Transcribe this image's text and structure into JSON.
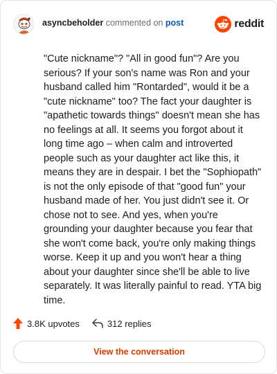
{
  "comment": {
    "username": "asyncbeholder",
    "commented_on": "commented on",
    "post_link": "post",
    "brand": "reddit",
    "body": "\"Cute nickname\"? \"All in good fun\"? Are you serious? If your son's name was Ron and your husband called him \"Rontarded\", would it be a \"cute nickname\" too? The fact your daughter is \"apathetic towards things\" doesn't mean she has no feelings at all. It seems you forgot about it long time ago – when calm and introverted people such as your daughter act like this, it means they are in despair. I bet the \"Sophiopath\" is not the only episode of that \"good fun\" your husband made of her. You just didn't see it. Or chose not to see. And yes, when you're grounding your daughter because you fear that she won't come back, you're only making things worse. Keep it up and you won't hear a thing about your daughter since she'll be able to live separately. It was literally painful to read. YTA big time."
  },
  "actions": {
    "upvotes": "3.8K upvotes",
    "replies": "312 replies"
  },
  "cta": {
    "label": "View the conversation"
  },
  "icons": {
    "avatar": "snoo-avatar-icon",
    "brand": "reddit-logo-icon",
    "upvote": "upvote-arrow-icon",
    "reply": "reply-arrow-icon"
  },
  "colors": {
    "brand_orange": "#ff4500",
    "cta_text": "#d93a00",
    "link_blue": "#0a58b8",
    "upvote": "#ff4500"
  }
}
